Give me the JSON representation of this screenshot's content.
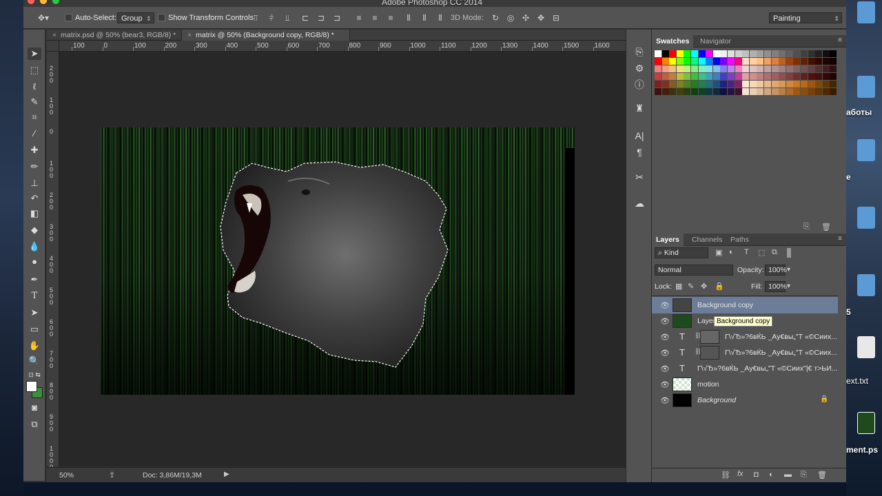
{
  "app": {
    "title": "Adobe Photoshop CC 2014"
  },
  "options_bar": {
    "auto_select_label": "Auto-Select:",
    "auto_select_value": "Group",
    "transform_label": "Show Transform Controls",
    "mode_3d_label": "3D Mode:",
    "workspace": "Painting"
  },
  "tabs": [
    {
      "label": "matrix.psd @ 50% (bear3, RGB/8) *",
      "active": false
    },
    {
      "label": "matrix @ 50% (Background copy, RGB/8) *",
      "active": true
    }
  ],
  "ruler_h_labels": [
    "100",
    "0",
    "100",
    "200",
    "300",
    "400",
    "500",
    "600",
    "700",
    "800",
    "900",
    "1000",
    "1100",
    "1200",
    "1300",
    "1400",
    "1500",
    "1600"
  ],
  "ruler_v_labels": [
    "2 0 0",
    "1 0 0",
    "0",
    "1 0 0",
    "2 0 0",
    "3 0 0",
    "4 0 0",
    "5 0 0",
    "6 0 0",
    "7 0 0",
    "8 0 0",
    "9 0 0",
    "1 0 0 0"
  ],
  "status": {
    "zoom": "50%",
    "doc": "Doc: 3,86M/19,3M"
  },
  "swatches_panel": {
    "tabs": [
      "Swatches",
      "Navigator"
    ]
  },
  "layers_panel": {
    "tabs": [
      "Layers",
      "Channels",
      "Paths"
    ],
    "filter_kind": "Kind",
    "blend_mode": "Normal",
    "opacity_label": "Opacity:",
    "opacity_value": "100%",
    "lock_label": "Lock:",
    "fill_label": "Fill:",
    "fill_value": "100%",
    "layers": [
      {
        "name": "Background copy",
        "type": "image",
        "selected": true
      },
      {
        "name": "Layer",
        "type": "image",
        "selected": false
      },
      {
        "name": "Г\\√Ђ»?6вЌЬ _Ау€вы„\"Т «©Сиих...",
        "type": "text",
        "selected": false
      },
      {
        "name": "Г\\√Ђ»?6вЌЬ _Ау€вы„\"Т «©Сиих...",
        "type": "text",
        "selected": false
      },
      {
        "name": "Г\\√Ђ»?6вЌЬ _Ау€вы„\"Т «©Сиих\"|€  т>ЬИ...",
        "type": "text",
        "selected": false
      },
      {
        "name": "motion",
        "type": "image",
        "selected": false
      },
      {
        "name": "Background",
        "type": "background",
        "selected": false
      }
    ],
    "tooltip": "Background copy"
  },
  "desktop": {
    "labels": [
      "аботы",
      "e",
      "5",
      "ext.txt",
      "ment.ps"
    ]
  },
  "colors": {
    "panel_bg": "#535353",
    "canvas_bg": "#282828",
    "selection": "#6b7d99"
  }
}
